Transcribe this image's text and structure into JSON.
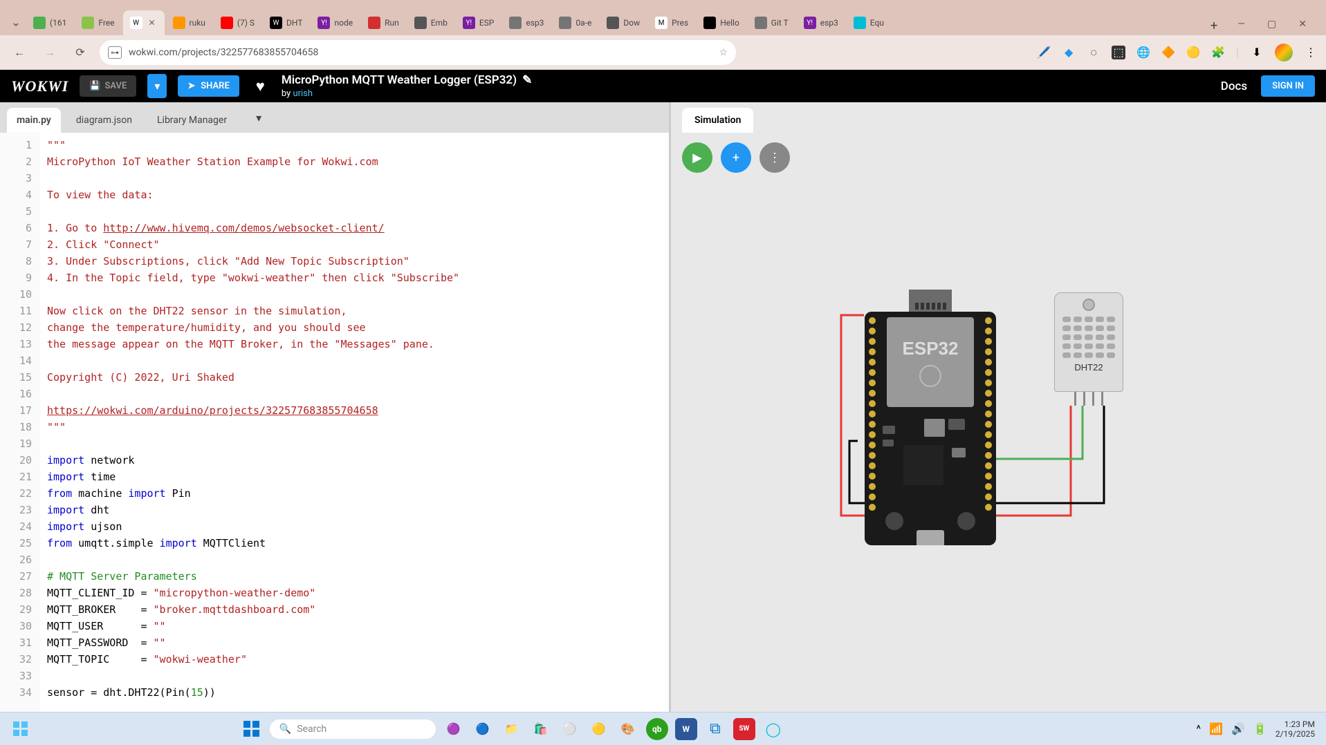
{
  "browser": {
    "tabs": [
      {
        "title": "(161",
        "favicon_bg": "#4caf50"
      },
      {
        "title": "Free",
        "favicon_bg": "#8bc34a"
      },
      {
        "active": true,
        "favicon_text": "W",
        "favicon_bg": "#fff"
      },
      {
        "title": "ruku",
        "favicon_bg": "#ff9800"
      },
      {
        "title": "(7) S",
        "favicon_bg": "#ff0000"
      },
      {
        "title": "DHT",
        "favicon_text": "W",
        "favicon_bg": "#000"
      },
      {
        "title": "node",
        "favicon_bg": "#7b1fa2",
        "favicon_text": "Y!"
      },
      {
        "title": "Run",
        "favicon_bg": "#d32f2f"
      },
      {
        "title": "Emb",
        "favicon_bg": "#555"
      },
      {
        "title": "ESP",
        "favicon_bg": "#7b1fa2",
        "favicon_text": "Y!"
      },
      {
        "title": "esp3",
        "favicon_bg": "#757575"
      },
      {
        "title": "0a-e",
        "favicon_bg": "#757575"
      },
      {
        "title": "Dow",
        "favicon_bg": "#555"
      },
      {
        "title": "Pres",
        "favicon_text": "M",
        "favicon_bg": "#fff"
      },
      {
        "title": "Hello",
        "favicon_bg": "#000"
      },
      {
        "title": "Git T",
        "favicon_bg": "#757575"
      },
      {
        "title": "esp3",
        "favicon_bg": "#7b1fa2",
        "favicon_text": "Y!"
      },
      {
        "title": "Equ",
        "favicon_bg": "#00bcd4"
      }
    ],
    "url": "wokwi.com/projects/322577683855704658"
  },
  "wokwi": {
    "logo": "WOKWI",
    "save": "SAVE",
    "share": "SHARE",
    "docs": "Docs",
    "signin": "SIGN IN",
    "project_title": "MicroPython MQTT Weather Logger (ESP32)",
    "by": "by ",
    "author": "urish"
  },
  "editor": {
    "tabs": [
      "main.py",
      "diagram.json",
      "Library Manager"
    ],
    "active_tab": 0,
    "code": [
      {
        "n": 1,
        "tokens": [
          {
            "t": "\"\"\"",
            "c": "str"
          }
        ]
      },
      {
        "n": 2,
        "tokens": [
          {
            "t": "MicroPython IoT Weather Station Example for Wokwi.com",
            "c": "str"
          }
        ]
      },
      {
        "n": 3,
        "tokens": []
      },
      {
        "n": 4,
        "tokens": [
          {
            "t": "To view the data:",
            "c": "str"
          }
        ]
      },
      {
        "n": 5,
        "tokens": []
      },
      {
        "n": 6,
        "tokens": [
          {
            "t": "1. Go to ",
            "c": "str"
          },
          {
            "t": "http://www.hivemq.com/demos/websocket-client/",
            "c": "str link"
          }
        ]
      },
      {
        "n": 7,
        "tokens": [
          {
            "t": "2. Click \"Connect\"",
            "c": "str"
          }
        ]
      },
      {
        "n": 8,
        "tokens": [
          {
            "t": "3. Under Subscriptions, click \"Add New Topic Subscription\"",
            "c": "str"
          }
        ]
      },
      {
        "n": 9,
        "tokens": [
          {
            "t": "4. In the Topic field, type \"wokwi-weather\" then click \"Subscribe\"",
            "c": "str"
          }
        ]
      },
      {
        "n": 10,
        "tokens": []
      },
      {
        "n": 11,
        "tokens": [
          {
            "t": "Now click on the DHT22 sensor in the simulation,",
            "c": "str"
          }
        ]
      },
      {
        "n": 12,
        "tokens": [
          {
            "t": "change the temperature/humidity, and you should see",
            "c": "str"
          }
        ]
      },
      {
        "n": 13,
        "tokens": [
          {
            "t": "the message appear on the MQTT Broker, in the \"Messages\" pane.",
            "c": "str"
          }
        ]
      },
      {
        "n": 14,
        "tokens": []
      },
      {
        "n": 15,
        "tokens": [
          {
            "t": "Copyright (C) 2022, Uri Shaked",
            "c": "str"
          }
        ]
      },
      {
        "n": 16,
        "tokens": []
      },
      {
        "n": 17,
        "tokens": [
          {
            "t": "https://wokwi.com/arduino/projects/322577683855704658",
            "c": "str link"
          }
        ]
      },
      {
        "n": 18,
        "tokens": [
          {
            "t": "\"\"\"",
            "c": "str"
          }
        ]
      },
      {
        "n": 19,
        "tokens": []
      },
      {
        "n": 20,
        "tokens": [
          {
            "t": "import",
            "c": "kw"
          },
          {
            "t": " network"
          }
        ]
      },
      {
        "n": 21,
        "tokens": [
          {
            "t": "import",
            "c": "kw"
          },
          {
            "t": " time"
          }
        ]
      },
      {
        "n": 22,
        "tokens": [
          {
            "t": "from",
            "c": "kw"
          },
          {
            "t": " machine "
          },
          {
            "t": "import",
            "c": "kw"
          },
          {
            "t": " Pin"
          }
        ]
      },
      {
        "n": 23,
        "tokens": [
          {
            "t": "import",
            "c": "kw"
          },
          {
            "t": " dht"
          }
        ]
      },
      {
        "n": 24,
        "tokens": [
          {
            "t": "import",
            "c": "kw"
          },
          {
            "t": " ujson"
          }
        ]
      },
      {
        "n": 25,
        "tokens": [
          {
            "t": "from",
            "c": "kw"
          },
          {
            "t": " umqtt.simple "
          },
          {
            "t": "import",
            "c": "kw"
          },
          {
            "t": " MQTTClient"
          }
        ]
      },
      {
        "n": 26,
        "tokens": []
      },
      {
        "n": 27,
        "tokens": [
          {
            "t": "# MQTT Server Parameters",
            "c": "com"
          }
        ]
      },
      {
        "n": 28,
        "tokens": [
          {
            "t": "MQTT_CLIENT_ID = "
          },
          {
            "t": "\"micropython-weather-demo\"",
            "c": "str"
          }
        ]
      },
      {
        "n": 29,
        "tokens": [
          {
            "t": "MQTT_BROKER    = "
          },
          {
            "t": "\"broker.mqttdashboard.com\"",
            "c": "str"
          }
        ]
      },
      {
        "n": 30,
        "tokens": [
          {
            "t": "MQTT_USER      = "
          },
          {
            "t": "\"\"",
            "c": "str"
          }
        ]
      },
      {
        "n": 31,
        "tokens": [
          {
            "t": "MQTT_PASSWORD  = "
          },
          {
            "t": "\"\"",
            "c": "str"
          }
        ]
      },
      {
        "n": 32,
        "tokens": [
          {
            "t": "MQTT_TOPIC     = "
          },
          {
            "t": "\"wokwi-weather\"",
            "c": "str"
          }
        ]
      },
      {
        "n": 33,
        "tokens": []
      },
      {
        "n": 34,
        "tokens": [
          {
            "t": "sensor = dht.DHT22(Pin("
          },
          {
            "t": "15",
            "c": "num"
          },
          {
            "t": "))"
          }
        ]
      }
    ]
  },
  "simulation": {
    "tab": "Simulation",
    "esp32_label": "ESP32",
    "dht22_label": "DHT22"
  },
  "taskbar": {
    "search_placeholder": "Search",
    "time": "1:23 PM",
    "date": "2/19/2025"
  }
}
